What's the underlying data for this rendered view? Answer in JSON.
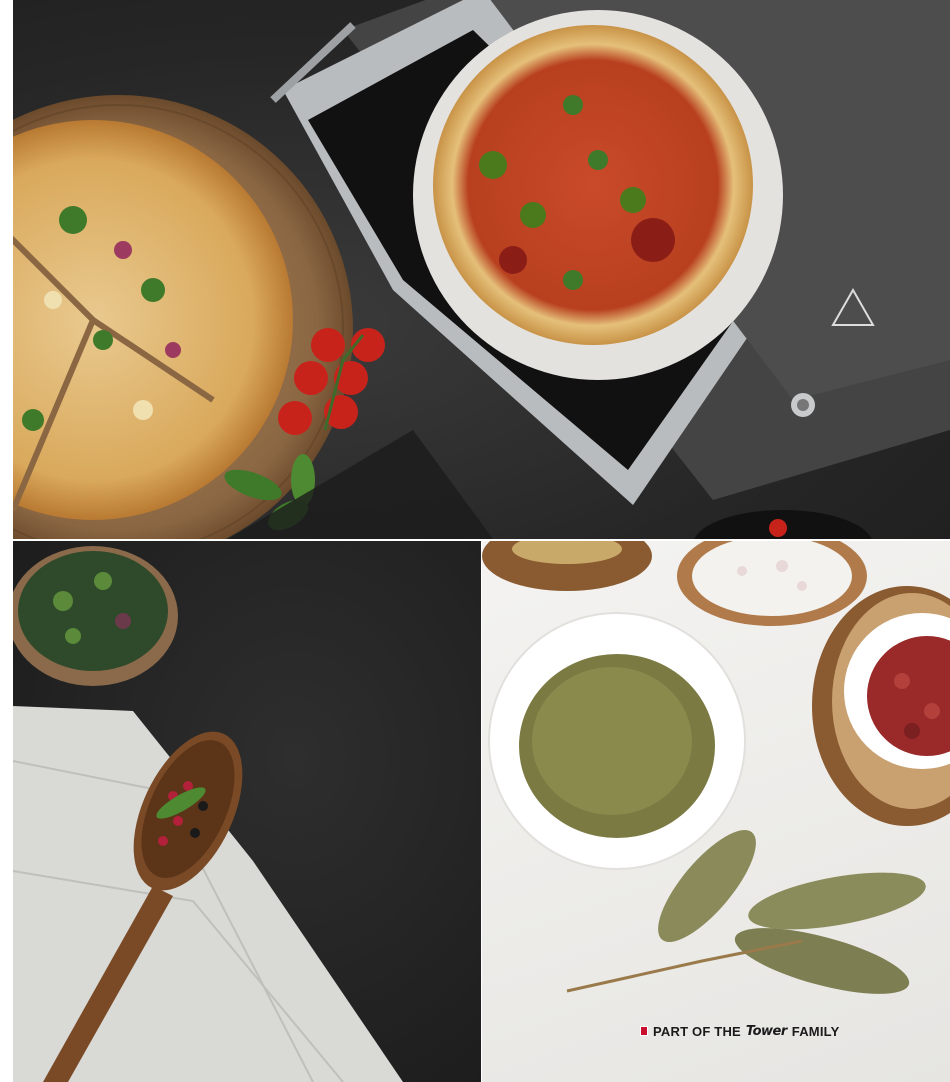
{
  "images": [
    {
      "subject": "pizza-oven-with-pizzas-and-tomatoes"
    },
    {
      "subject": "wooden-spoon-peppercorns-cloth"
    },
    {
      "subject": "herbs-salt-peppercorns-bay-leaves"
    }
  ],
  "branding": {
    "prefix": "PART OF THE",
    "brand": "Tower",
    "suffix": "FAMILY",
    "flag_color": "#c8102e",
    "text_color": "#1a1a1a"
  }
}
